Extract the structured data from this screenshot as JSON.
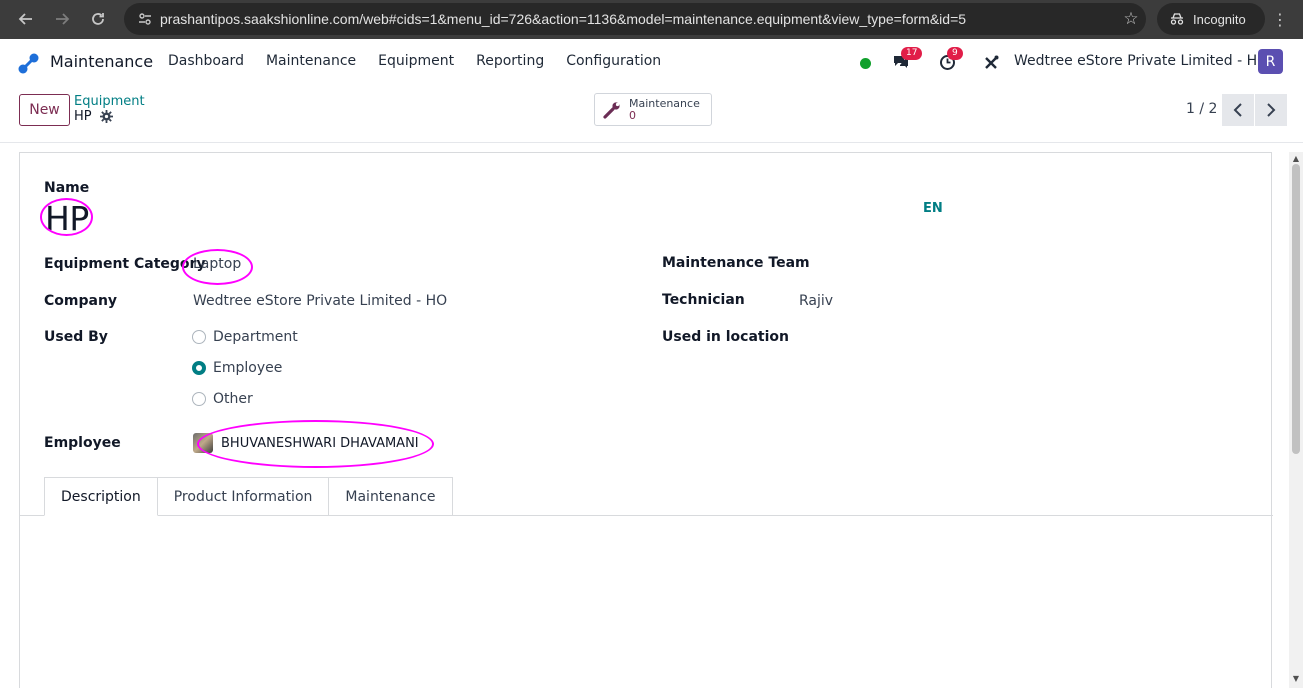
{
  "browser": {
    "url": "prashantipos.saakshionline.com/web#cids=1&menu_id=726&action=1136&model=maintenance.equipment&view_type=form&id=5",
    "incognito_label": "Incognito"
  },
  "nav": {
    "app_name": "Maintenance",
    "menu": [
      "Dashboard",
      "Maintenance",
      "Equipment",
      "Reporting",
      "Configuration"
    ],
    "messages_count": "17",
    "activities_count": "9",
    "company": "Wedtree eStore Private Limited - HO",
    "user_initial": "R"
  },
  "control": {
    "new_label": "New",
    "breadcrumb_parent": "Equipment",
    "breadcrumb_current": "HP",
    "smart_label": "Maintenance",
    "smart_value": "0",
    "pager": "1 / 2"
  },
  "form": {
    "name_label": "Name",
    "name_value": "HP",
    "lang": "EN",
    "category_label": "Equipment Category",
    "category_value": "Laptop",
    "company_label": "Company",
    "company_value": "Wedtree eStore Private Limited - HO",
    "used_by_label": "Used By",
    "used_by_options": [
      "Department",
      "Employee",
      "Other"
    ],
    "used_by_selected": "Employee",
    "employee_label": "Employee",
    "employee_value": "BHUVANESHWARI DHAVAMANI",
    "team_label": "Maintenance Team",
    "technician_label": "Technician",
    "technician_value": "Rajiv",
    "location_label": "Used in location",
    "tabs": [
      "Description",
      "Product Information",
      "Maintenance"
    ]
  },
  "colors": {
    "accent": "#017e84",
    "brand": "#7c2d52",
    "annotation": "#ff00ff"
  }
}
